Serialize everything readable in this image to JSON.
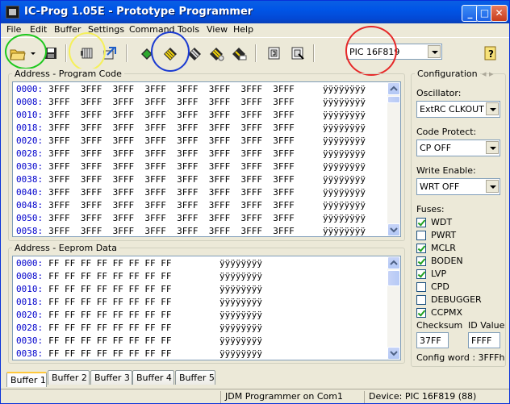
{
  "window": {
    "title": "IC-Prog 1.05E - Prototype Programmer"
  },
  "menu": [
    "File",
    "Edit",
    "Buffer",
    "Settings",
    "Command",
    "Tools",
    "View",
    "Help"
  ],
  "toolbar": {
    "device": "PIC 16F819",
    "icons": [
      "open-file-icon",
      "dropdown-arrow-icon",
      "save-icon",
      "config-icon",
      "options-icon",
      "read-chip-icon",
      "program-chip-icon",
      "erase-chip-icon",
      "verify-chip-icon",
      "blank-check-icon",
      "buffer-view-icon",
      "window-select-icon",
      "help-icon"
    ],
    "accent": {
      "green_ring": "#1ec81e",
      "yellow_ring": "#f5f05a",
      "blue_ring": "#1c3cd2",
      "red_ring": "#e62828"
    }
  },
  "program_code": {
    "label": "Address - Program Code",
    "rows": [
      {
        "addr": "0000:",
        "data": "3FFF  3FFF  3FFF  3FFF  3FFF  3FFF  3FFF  3FFF",
        "ascii": "ÿÿÿÿÿÿÿÿ"
      },
      {
        "addr": "0008:",
        "data": "3FFF  3FFF  3FFF  3FFF  3FFF  3FFF  3FFF  3FFF",
        "ascii": "ÿÿÿÿÿÿÿÿ"
      },
      {
        "addr": "0010:",
        "data": "3FFF  3FFF  3FFF  3FFF  3FFF  3FFF  3FFF  3FFF",
        "ascii": "ÿÿÿÿÿÿÿÿ"
      },
      {
        "addr": "0018:",
        "data": "3FFF  3FFF  3FFF  3FFF  3FFF  3FFF  3FFF  3FFF",
        "ascii": "ÿÿÿÿÿÿÿÿ"
      },
      {
        "addr": "0020:",
        "data": "3FFF  3FFF  3FFF  3FFF  3FFF  3FFF  3FFF  3FFF",
        "ascii": "ÿÿÿÿÿÿÿÿ"
      },
      {
        "addr": "0028:",
        "data": "3FFF  3FFF  3FFF  3FFF  3FFF  3FFF  3FFF  3FFF",
        "ascii": "ÿÿÿÿÿÿÿÿ"
      },
      {
        "addr": "0030:",
        "data": "3FFF  3FFF  3FFF  3FFF  3FFF  3FFF  3FFF  3FFF",
        "ascii": "ÿÿÿÿÿÿÿÿ"
      },
      {
        "addr": "0038:",
        "data": "3FFF  3FFF  3FFF  3FFF  3FFF  3FFF  3FFF  3FFF",
        "ascii": "ÿÿÿÿÿÿÿÿ"
      },
      {
        "addr": "0040:",
        "data": "3FFF  3FFF  3FFF  3FFF  3FFF  3FFF  3FFF  3FFF",
        "ascii": "ÿÿÿÿÿÿÿÿ"
      },
      {
        "addr": "0048:",
        "data": "3FFF  3FFF  3FFF  3FFF  3FFF  3FFF  3FFF  3FFF",
        "ascii": "ÿÿÿÿÿÿÿÿ"
      },
      {
        "addr": "0050:",
        "data": "3FFF  3FFF  3FFF  3FFF  3FFF  3FFF  3FFF  3FFF",
        "ascii": "ÿÿÿÿÿÿÿÿ"
      },
      {
        "addr": "0058:",
        "data": "3FFF  3FFF  3FFF  3FFF  3FFF  3FFF  3FFF  3FFF",
        "ascii": "ÿÿÿÿÿÿÿÿ"
      }
    ]
  },
  "eeprom": {
    "label": "Address - Eeprom Data",
    "rows": [
      {
        "addr": "0000:",
        "data": "FF FF FF FF FF FF FF FF",
        "ascii": "ÿÿÿÿÿÿÿÿ"
      },
      {
        "addr": "0008:",
        "data": "FF FF FF FF FF FF FF FF",
        "ascii": "ÿÿÿÿÿÿÿÿ"
      },
      {
        "addr": "0010:",
        "data": "FF FF FF FF FF FF FF FF",
        "ascii": "ÿÿÿÿÿÿÿÿ"
      },
      {
        "addr": "0018:",
        "data": "FF FF FF FF FF FF FF FF",
        "ascii": "ÿÿÿÿÿÿÿÿ"
      },
      {
        "addr": "0020:",
        "data": "FF FF FF FF FF FF FF FF",
        "ascii": "ÿÿÿÿÿÿÿÿ"
      },
      {
        "addr": "0028:",
        "data": "FF FF FF FF FF FF FF FF",
        "ascii": "ÿÿÿÿÿÿÿÿ"
      },
      {
        "addr": "0030:",
        "data": "FF FF FF FF FF FF FF FF",
        "ascii": "ÿÿÿÿÿÿÿÿ"
      },
      {
        "addr": "0038:",
        "data": "FF FF FF FF FF FF FF FF",
        "ascii": "ÿÿÿÿÿÿÿÿ"
      }
    ]
  },
  "config": {
    "label": "Configuration",
    "oscillator_label": "Oscillator:",
    "oscillator_value": "ExtRC CLKOUT",
    "code_protect_label": "Code Protect:",
    "code_protect_value": "CP OFF",
    "write_enable_label": "Write Enable:",
    "write_enable_value": "WRT OFF",
    "fuses_label": "Fuses:",
    "fuses": [
      {
        "name": "WDT",
        "checked": true
      },
      {
        "name": "PWRT",
        "checked": false
      },
      {
        "name": "MCLR",
        "checked": true
      },
      {
        "name": "BODEN",
        "checked": true
      },
      {
        "name": "LVP",
        "checked": true
      },
      {
        "name": "CPD",
        "checked": false
      },
      {
        "name": "DEBUGGER",
        "checked": false
      },
      {
        "name": "CCPMX",
        "checked": true
      }
    ],
    "checksum_label": "Checksum",
    "checksum_value": "37FF",
    "id_label": "ID Value",
    "id_value": "FFFF",
    "config_word": "Config word : 3FFFh"
  },
  "tabs": [
    "Buffer 1",
    "Buffer 2",
    "Buffer 3",
    "Buffer 4",
    "Buffer 5"
  ],
  "status": {
    "programmer": "JDM Programmer on Com1",
    "device": "Device: PIC 16F819  (88)"
  }
}
